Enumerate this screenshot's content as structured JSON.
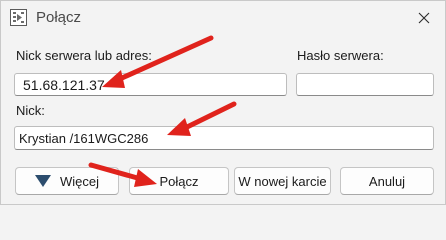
{
  "window": {
    "title": "Połącz",
    "icon": "connect-app-icon",
    "close_icon": "close-icon"
  },
  "form": {
    "server_label": "Nick serwera lub adres:",
    "server_value": "51.68.121.37",
    "password_label": "Hasło serwera:",
    "password_value": "",
    "nick_label": "Nick:",
    "nick_value": "Krystian /161WGC286"
  },
  "buttons": {
    "more_label": "Więcej",
    "connect_label": "Połącz",
    "new_tab_label": "W nowej karcie",
    "cancel_label": "Anuluj"
  },
  "annotations": {
    "arrow_color": "#e0231c"
  }
}
